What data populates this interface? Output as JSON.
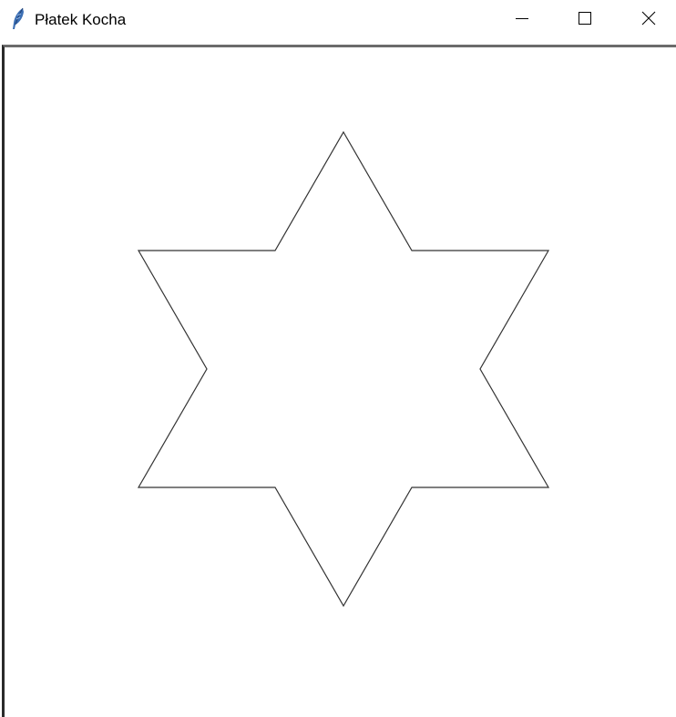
{
  "window": {
    "title": "Płatek Kocha",
    "icon": "feather-icon",
    "controls": {
      "minimize_icon": "minimize-icon",
      "maximize_icon": "maximize-icon",
      "close_icon": "close-icon"
    }
  },
  "canvas": {
    "background": "#ffffff",
    "stroke_color": "#333333",
    "shape": "hexagram"
  }
}
